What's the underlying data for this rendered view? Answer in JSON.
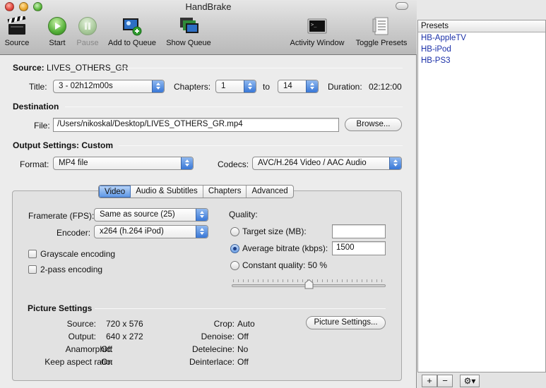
{
  "window": {
    "title": "HandBrake"
  },
  "toolbar": {
    "source": "Source",
    "start": "Start",
    "pause": "Pause",
    "add_to_queue": "Add to Queue",
    "show_queue": "Show Queue",
    "activity_window": "Activity Window",
    "toggle_presets": "Toggle Presets"
  },
  "source": {
    "label": "Source:",
    "name": "LIVES_OTHERS_GR",
    "title_label": "Title:",
    "title_value": "3 - 02h12m00s",
    "chapters_label": "Chapters:",
    "chapter_from": "1",
    "to_label": "to",
    "chapter_to": "14",
    "duration_label": "Duration:",
    "duration_value": "02:12:00"
  },
  "destination": {
    "heading": "Destination",
    "file_label": "File:",
    "file_value": "/Users/nikoskal/Desktop/LIVES_OTHERS_GR.mp4",
    "browse": "Browse..."
  },
  "output": {
    "heading": "Output Settings:",
    "preset_name": "Custom",
    "format_label": "Format:",
    "format_value": "MP4 file",
    "codecs_label": "Codecs:",
    "codecs_value": "AVC/H.264 Video / AAC Audio"
  },
  "tabs": [
    "Video",
    "Audio & Subtitles",
    "Chapters",
    "Advanced"
  ],
  "video": {
    "framerate_label": "Framerate (FPS):",
    "framerate_value": "Same as source (25)",
    "encoder_label": "Encoder:",
    "encoder_value": "x264 (h.264 iPod)",
    "grayscale": "Grayscale encoding",
    "twopass": "2-pass encoding",
    "quality_label": "Quality:",
    "target_size": "Target size (MB):",
    "target_size_value": "",
    "avg_bitrate": "Average bitrate (kbps):",
    "avg_bitrate_value": "1500",
    "constant_quality": "Constant quality: 50 %",
    "quality_slider_fraction": 0.5
  },
  "picture": {
    "heading": "Picture Settings",
    "source_label": "Source:",
    "source_value": "720 x 576",
    "output_label": "Output:",
    "output_value": "640 x 272",
    "anamorphic_label": "Anamorphic:",
    "anamorphic_value": "Off",
    "keep_aspect_label": "Keep aspect ratio:",
    "keep_aspect_value": "On",
    "crop_label": "Crop:",
    "crop_value": "Auto",
    "denoise_label": "Denoise:",
    "denoise_value": "Off",
    "detelecine_label": "Detelecine:",
    "detelecine_value": "No",
    "deinterlace_label": "Deinterlace:",
    "deinterlace_value": "Off",
    "button": "Picture Settings..."
  },
  "presets": {
    "header": "Presets",
    "items": [
      "HB-AppleTV",
      "HB-iPod",
      "HB-PS3"
    ],
    "add": "+",
    "remove": "−",
    "gear": "⚙▾"
  },
  "colors": {
    "preset_text": "#1a2fa8",
    "accent": "#3877d7"
  }
}
